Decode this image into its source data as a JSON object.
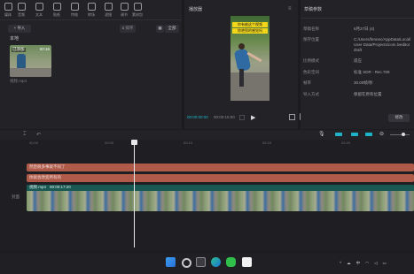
{
  "toolbar": {
    "items": [
      {
        "label": "媒体",
        "icon": "media-icon"
      },
      {
        "label": "音频",
        "icon": "audio-icon"
      },
      {
        "label": "文本",
        "icon": "text-icon"
      },
      {
        "label": "贴纸",
        "icon": "sticker-icon"
      },
      {
        "label": "特效",
        "icon": "effects-icon"
      },
      {
        "label": "转场",
        "icon": "transition-icon"
      },
      {
        "label": "滤镜",
        "icon": "filter-icon"
      },
      {
        "label": "调节",
        "icon": "adjust-icon"
      },
      {
        "label": "素材包",
        "icon": "package-icon"
      }
    ]
  },
  "media": {
    "section": "本地",
    "import_label": "导入",
    "sort_label": "排序",
    "all_label": "全部",
    "thumb_duration": "00:16",
    "thumb_name": "视频.mp4",
    "thumb_caption": "已添加"
  },
  "player": {
    "title": "播放器",
    "current_time": "00:00:00:00",
    "total_time": "00:00:15:00",
    "ratio_label": "原始",
    "subtitle_line1": "你有被这个视频",
    "subtitle_line2": "惊艳到的感觉吗"
  },
  "properties": {
    "title": "草稿参数",
    "rows": [
      {
        "label": "草稿名称",
        "value": "6月27日 (4)"
      },
      {
        "label": "保存位置",
        "value": "C:/Users/fennec/AppData/Local/"
      },
      {
        "label": "",
        "value": "User Data/Projects/com.lveditor"
      },
      {
        "label": "",
        "value": "draft"
      },
      {
        "label": "比例模式",
        "value": "适应"
      },
      {
        "label": "色彩空间",
        "value": "标准 SDR - Rec.709"
      },
      {
        "label": "帧率",
        "value": "30.00帧/秒"
      },
      {
        "label": "导入方式",
        "value": "保留在原有位置"
      }
    ],
    "modify_label": "修改"
  },
  "timeline": {
    "ruler_ticks": [
      "00:00",
      "00:05",
      "00:10",
      "00:15",
      "00:20"
    ],
    "text_track_1": "然后很多事就不同了",
    "text_track_2": "你就会改变所有的",
    "video_clip_name": "视频.mp4",
    "video_clip_duration": "00:00:17:20",
    "cover_label": "封面"
  },
  "taskbar": {
    "time": "",
    "icons": [
      "windows-start-icon",
      "search-icon",
      "task-view-icon",
      "edge-icon",
      "wechat-icon",
      "capcut-icon"
    ]
  },
  "colors": {
    "text_track": "#b05a4a",
    "video_track": "#1f6e66",
    "accent": "#1fb4c8",
    "playhead": "#e8e8e8"
  }
}
